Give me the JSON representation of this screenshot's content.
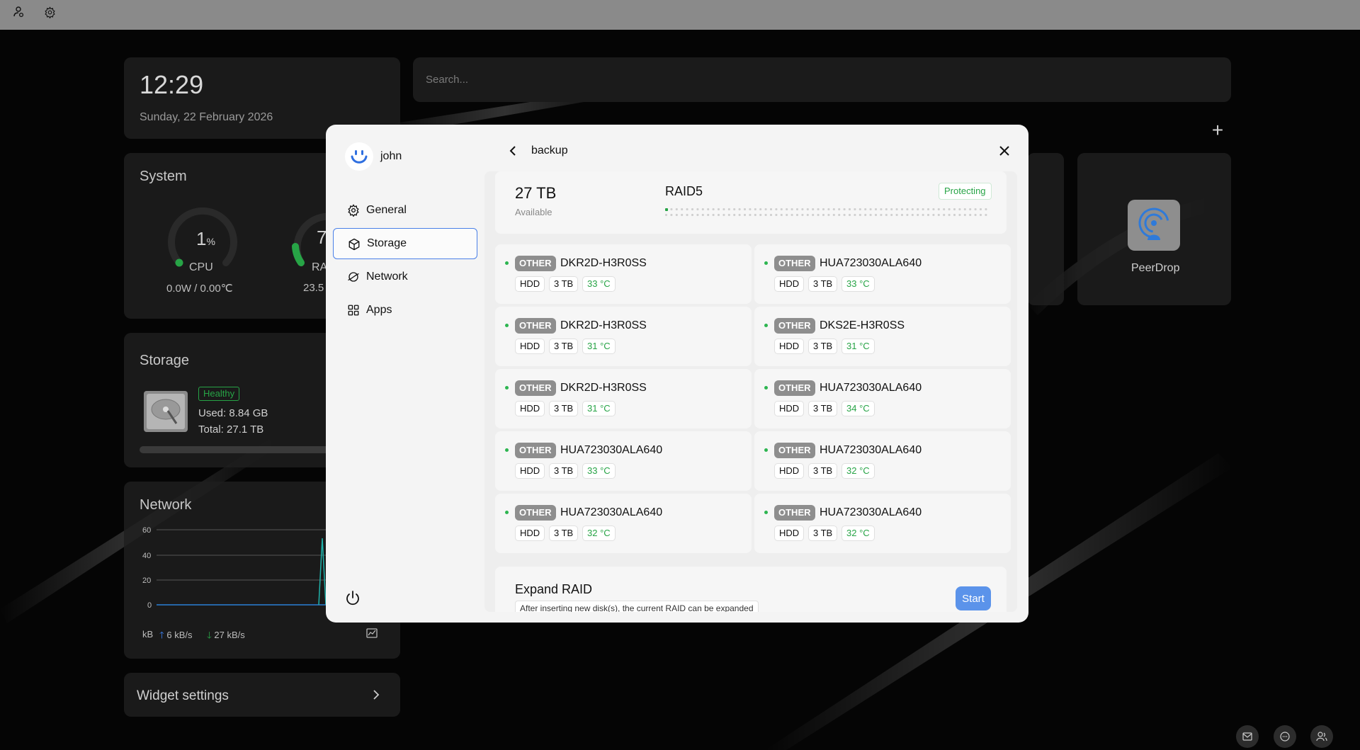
{
  "topbar": {
    "icons": [
      "user-network-icon",
      "gear-icon"
    ]
  },
  "clock": {
    "time": "12:29",
    "date": "Sunday, 22 February 2026"
  },
  "search": {
    "placeholder": "Search..."
  },
  "system": {
    "title": "System",
    "cpu": {
      "value": "1",
      "unit": "%",
      "label": "CPU",
      "sub": "0.0W / 0.00℃",
      "level": 0.01
    },
    "ram": {
      "value_partial": "7",
      "label_partial": "RA",
      "sub_partial": "23.5"
    }
  },
  "storage_widget": {
    "title": "Storage",
    "status": "Healthy",
    "used": "Used: 8.84 GB",
    "total": "Total: 27.1 TB"
  },
  "network_widget": {
    "title": "Network",
    "y_ticks": [
      "60",
      "40",
      "20",
      "0"
    ],
    "unit": "kB",
    "upload": "6 kB/s",
    "download": "27 kB/s"
  },
  "widget_settings": {
    "label": "Widget settings"
  },
  "apps": [
    {
      "name": "PeerDrop",
      "icon": "peerdrop-icon"
    }
  ],
  "modal": {
    "user": {
      "name": "john"
    },
    "nav": [
      {
        "label": "General",
        "icon": "gear-icon",
        "active": false
      },
      {
        "label": "Storage",
        "icon": "storage-cube-icon",
        "active": true
      },
      {
        "label": "Network",
        "icon": "network-icon",
        "active": false
      },
      {
        "label": "Apps",
        "icon": "apps-grid-icon",
        "active": false
      }
    ],
    "panel_title": "backup",
    "summary": {
      "size": "27 TB",
      "available_label": "Available",
      "raid": "RAID5",
      "status": "Protecting",
      "progress_fraction": 0.01
    },
    "disks": [
      {
        "type": "OTHER",
        "model": "DKR2D-H3R0SS",
        "kind": "HDD",
        "size": "3 TB",
        "temp": "33 °C"
      },
      {
        "type": "OTHER",
        "model": "HUA723030ALA640",
        "kind": "HDD",
        "size": "3 TB",
        "temp": "33 °C"
      },
      {
        "type": "OTHER",
        "model": "DKR2D-H3R0SS",
        "kind": "HDD",
        "size": "3 TB",
        "temp": "31 °C"
      },
      {
        "type": "OTHER",
        "model": "DKS2E-H3R0SS",
        "kind": "HDD",
        "size": "3 TB",
        "temp": "31 °C"
      },
      {
        "type": "OTHER",
        "model": "DKR2D-H3R0SS",
        "kind": "HDD",
        "size": "3 TB",
        "temp": "31 °C"
      },
      {
        "type": "OTHER",
        "model": "HUA723030ALA640",
        "kind": "HDD",
        "size": "3 TB",
        "temp": "34 °C"
      },
      {
        "type": "OTHER",
        "model": "HUA723030ALA640",
        "kind": "HDD",
        "size": "3 TB",
        "temp": "33 °C"
      },
      {
        "type": "OTHER",
        "model": "HUA723030ALA640",
        "kind": "HDD",
        "size": "3 TB",
        "temp": "32 °C"
      },
      {
        "type": "OTHER",
        "model": "HUA723030ALA640",
        "kind": "HDD",
        "size": "3 TB",
        "temp": "32 °C"
      },
      {
        "type": "OTHER",
        "model": "HUA723030ALA640",
        "kind": "HDD",
        "size": "3 TB",
        "temp": "32 °C"
      }
    ],
    "expand": {
      "title": "Expand RAID",
      "description": "After inserting new disk(s), the current RAID can be expanded",
      "button": "Start"
    }
  },
  "bottom_buttons": [
    "mail-icon",
    "chat-icon",
    "users-icon"
  ],
  "colors": {
    "accent": "#4a80e8",
    "ok_green": "#27a446",
    "start_button": "#5b93ea"
  }
}
